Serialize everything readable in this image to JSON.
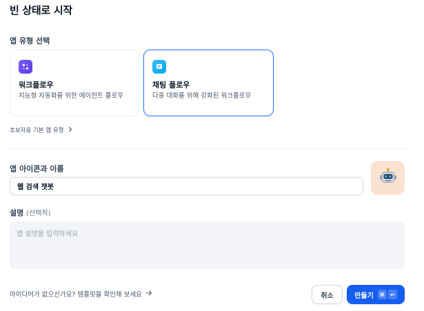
{
  "page": {
    "title": "빈 상태로 시작"
  },
  "app_type": {
    "label": "앱 유형 선택",
    "cards": [
      {
        "title": "워크플로우",
        "description": "지능형 자동화를 위한 에이전트 플로우",
        "icon": "workflow-icon",
        "selected": false
      },
      {
        "title": "채팅 플로우",
        "description": "다중 대화를 위해 강화된 워크플로우",
        "icon": "chatflow-icon",
        "selected": true
      }
    ],
    "beginner_link": "초보자용 기본 앱 유형"
  },
  "name_section": {
    "label": "앱 아이콘과 이름",
    "name_value": "웹 검색 챗봇",
    "avatar_icon": "robot-icon"
  },
  "description_section": {
    "label": "설명",
    "optional": "(선택적)",
    "placeholder": "앱 설명을 입력하세요"
  },
  "footer": {
    "idea_link": "아이디어가 없으신가요? 템플릿을 확인해 보세요",
    "cancel": "취소",
    "create": "만들기",
    "shortcut_1": "⌘",
    "shortcut_2": "↵"
  },
  "colors": {
    "primary": "#155eef",
    "selected_border": "#2970ff",
    "workflow_icon_bg": "#6e4ff0",
    "chatflow_icon_bg": "#1fb0f5",
    "avatar_bg": "#fbe1cf"
  }
}
